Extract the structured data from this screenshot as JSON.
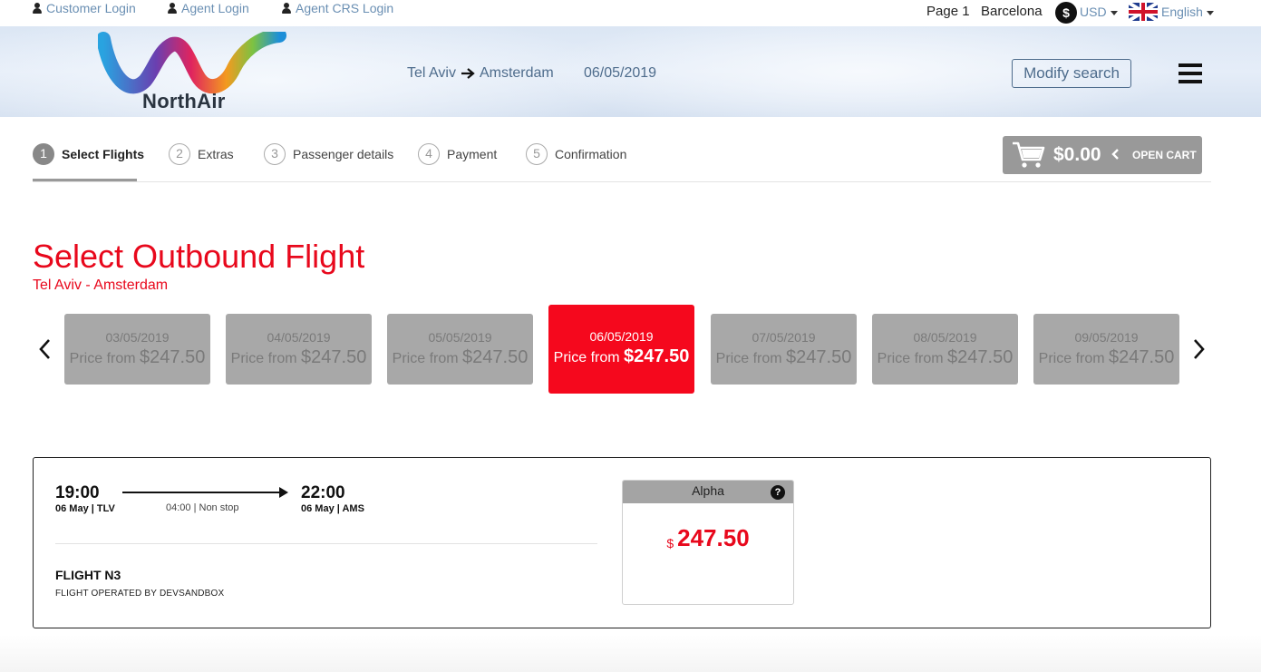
{
  "topbar": {
    "customer_login": "Customer Login",
    "agent_login": "Agent Login",
    "agent_crs_login": "Agent CRS Login",
    "page_label": "Page 1",
    "city": "Barcelona",
    "currency_symbol": "$",
    "currency": "USD",
    "language": "English"
  },
  "header": {
    "logo_text": "NorthAir",
    "origin": "Tel Aviv",
    "destination": "Amsterdam",
    "date": "06/05/2019",
    "modify_label": "Modify search"
  },
  "steps": [
    {
      "num": "1",
      "label": "Select Flights",
      "active": true
    },
    {
      "num": "2",
      "label": "Extras"
    },
    {
      "num": "3",
      "label": "Passenger details"
    },
    {
      "num": "4",
      "label": "Payment"
    },
    {
      "num": "5",
      "label": "Confirmation"
    }
  ],
  "cart": {
    "amount": "$0.00",
    "label": "OPEN CART"
  },
  "page": {
    "title": "Select Outbound Flight",
    "subtitle": "Tel Aviv - Amsterdam"
  },
  "dates": [
    {
      "date": "03/05/2019",
      "price_prefix": "Price from ",
      "currency": "$",
      "price": "247.50"
    },
    {
      "date": "04/05/2019",
      "price_prefix": "Price from ",
      "currency": "$",
      "price": "247.50"
    },
    {
      "date": "05/05/2019",
      "price_prefix": "Price from ",
      "currency": "$",
      "price": "247.50"
    },
    {
      "date": "06/05/2019",
      "price_prefix": "Price from ",
      "currency": "$",
      "price": "247.50",
      "selected": true
    },
    {
      "date": "07/05/2019",
      "price_prefix": "Price from ",
      "currency": "$",
      "price": "247.50"
    },
    {
      "date": "08/05/2019",
      "price_prefix": "Price from ",
      "currency": "$",
      "price": "247.50"
    },
    {
      "date": "09/05/2019",
      "price_prefix": "Price from ",
      "currency": "$",
      "price": "247.50"
    }
  ],
  "flight": {
    "depart_time": "19:00",
    "depart_info": "06 May | TLV",
    "arrive_time": "22:00",
    "arrive_info": "06 May | AMS",
    "duration": "04:00 | Non stop",
    "name": "FLIGHT N3",
    "operator": "FLIGHT OPERATED BY DEVSANDBOX",
    "fare": {
      "class_name": "Alpha",
      "help": "?",
      "currency": "$",
      "price": "247.50"
    }
  },
  "colors": {
    "accent_red": "#f5081d",
    "link_blue": "#6a8fb3",
    "header_text": "#4e6c8c",
    "inactive_card": "#a8a8a8"
  }
}
